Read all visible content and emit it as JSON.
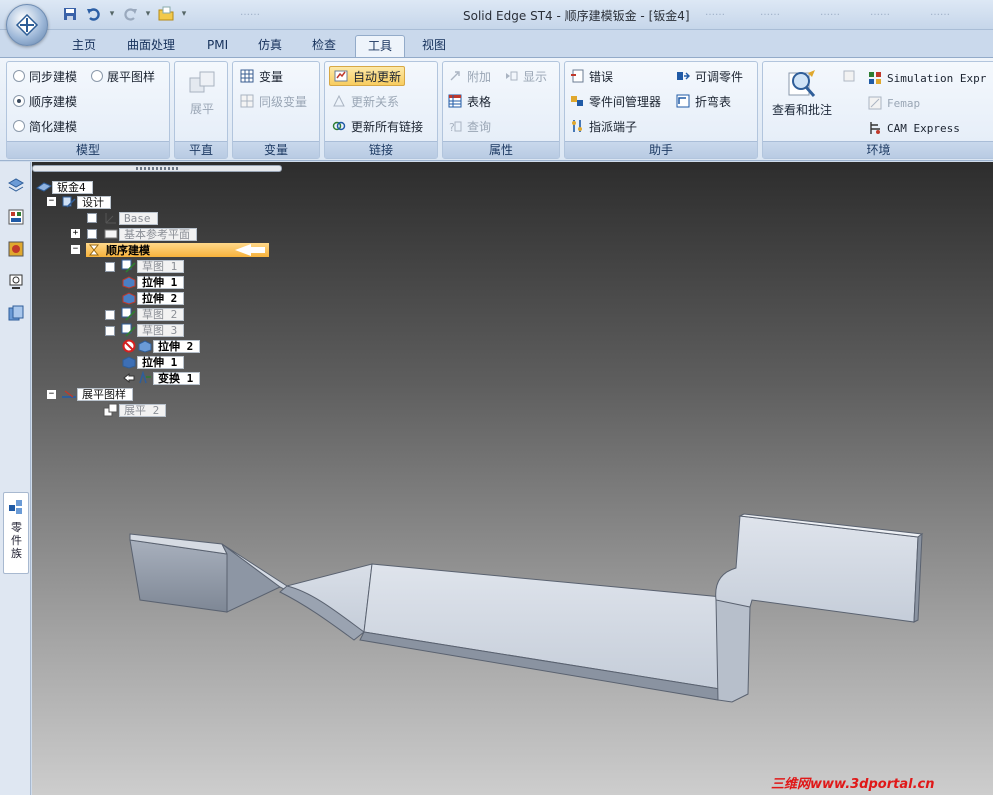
{
  "window": {
    "title": "Solid Edge ST4 - 顺序建模钣金 - [钣金4]",
    "title_ghosts": [
      "……",
      "……",
      "……",
      "……",
      "……",
      "……",
      "……"
    ]
  },
  "tabs": [
    {
      "label": "主页"
    },
    {
      "label": "曲面处理"
    },
    {
      "label": "PMI"
    },
    {
      "label": "仿真"
    },
    {
      "label": "检查"
    },
    {
      "label": "工具",
      "active": true
    },
    {
      "label": "视图"
    }
  ],
  "ribbon": {
    "model": {
      "label": "模型",
      "sync": "同步建模",
      "ordered": "顺序建模",
      "simplified": "简化建模",
      "flat_pattern": "展平图样",
      "selected": "顺序建模"
    },
    "flatten": {
      "label": "平直",
      "button": "展平"
    },
    "variables": {
      "label": "变量",
      "var": "变量",
      "peer_var": "同级变量"
    },
    "links": {
      "label": "链接",
      "auto_update": "自动更新",
      "update_rel": "更新关系",
      "update_all": "更新所有链接"
    },
    "properties": {
      "label": "属性",
      "attach": "附加",
      "show": "显示",
      "table": "表格",
      "query": "查询"
    },
    "assistant": {
      "label": "助手",
      "errors": "错误",
      "adjustable": "可调零件",
      "interpart": "零件间管理器",
      "bend_table": "折弯表",
      "assign_terminal": "指派端子"
    },
    "review": {
      "label": "",
      "button": "查看和批注"
    },
    "environment": {
      "label": "环境",
      "simulation": "Simulation Expr",
      "femap": "Femap",
      "cam": "CAM Express"
    }
  },
  "sidebar": {
    "tab_label": "零件族"
  },
  "tree": {
    "root": "钣金4",
    "design": "设计",
    "base": "Base",
    "base_planes": "基本参考平面",
    "ordered": "顺序建模",
    "sketch1": "草图 1",
    "extrude1a": "拉伸 1",
    "extrude2a": "拉伸 2",
    "sketch2": "草图 2",
    "sketch3": "草图 3",
    "extrude2b": "拉伸 2",
    "extrude1b": "拉伸 1",
    "transform1": "变换 1",
    "flat_pattern": "展平图样",
    "flatten2": "展平 2"
  },
  "watermark": "三维网www.3dportal.cn",
  "colors": {
    "ribbon_accent": "#f7b23c",
    "part_fill": "#c8d0dc",
    "part_shadow": "#8e97a5"
  }
}
